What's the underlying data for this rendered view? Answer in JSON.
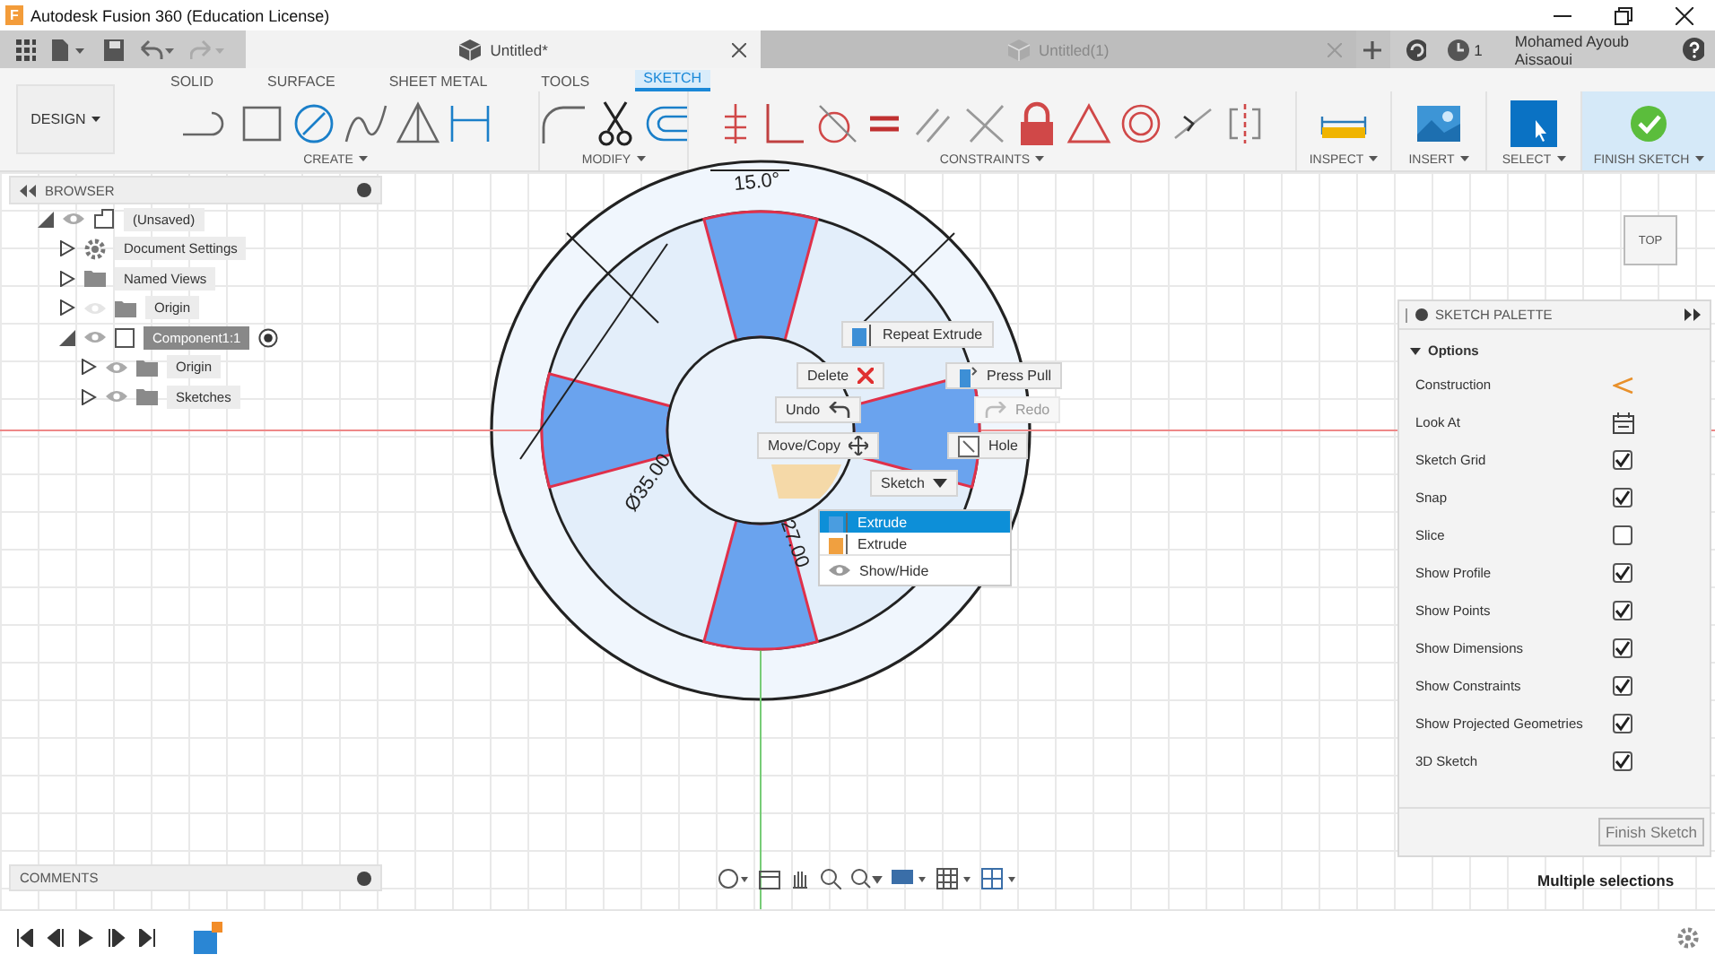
{
  "title_bar": {
    "logo": "F",
    "title": "Autodesk Fusion 360 (Education License)"
  },
  "doc_tabs": [
    {
      "label": "Untitled*",
      "selected": true
    },
    {
      "label": "Untitled(1)",
      "selected": false
    }
  ],
  "notifications": "1",
  "user": "Mohamed Ayoub Aissaoui",
  "ribbon": {
    "workspace": "DESIGN",
    "tabs": [
      {
        "label": "SOLID",
        "selected": false
      },
      {
        "label": "SURFACE",
        "selected": false
      },
      {
        "label": "SHEET METAL",
        "selected": false
      },
      {
        "label": "TOOLS",
        "selected": false
      },
      {
        "label": "SKETCH",
        "selected": true
      }
    ],
    "groups": [
      "CREATE",
      "MODIFY",
      "CONSTRAINTS",
      "INSPECT",
      "INSERT",
      "SELECT",
      "FINISH SKETCH"
    ]
  },
  "browser": {
    "title": "BROWSER",
    "tree": [
      {
        "label": "(Unsaved)",
        "kind": "document",
        "expanded": true,
        "visible": true,
        "selected": false,
        "children": [
          {
            "label": "Document Settings",
            "kind": "settings",
            "expanded": false,
            "selected": false
          },
          {
            "label": "Named Views",
            "kind": "folder",
            "expanded": false,
            "selected": false
          },
          {
            "label": "Origin",
            "kind": "folder",
            "expanded": false,
            "visible": false,
            "selected": false
          },
          {
            "label": "Component1:1",
            "kind": "component",
            "expanded": true,
            "visible": true,
            "active": true,
            "selected": true,
            "children": [
              {
                "label": "Origin",
                "kind": "folder",
                "expanded": false,
                "visible": true,
                "selected": false
              },
              {
                "label": "Sketches",
                "kind": "folder",
                "expanded": false,
                "visible": true,
                "selected": false
              }
            ]
          }
        ]
      }
    ]
  },
  "sketch_labels": [
    "15.0°",
    "Ø35.00",
    "27.00"
  ],
  "marking_menu": [
    {
      "label": "Repeat Extrude",
      "disabled": false
    },
    {
      "label": "Delete",
      "disabled": false
    },
    {
      "label": "Press Pull",
      "disabled": false
    },
    {
      "label": "Undo",
      "disabled": false
    },
    {
      "label": "Redo",
      "disabled": true
    },
    {
      "label": "Move/Copy",
      "disabled": false
    },
    {
      "label": "Hole",
      "disabled": false
    },
    {
      "label": "Sketch",
      "disabled": false
    }
  ],
  "overflow_menu": [
    {
      "label": "Extrude",
      "selected": true
    },
    {
      "label": "Extrude",
      "selected": false
    },
    {
      "label": "Show/Hide",
      "selected": false
    }
  ],
  "view_cube": "TOP",
  "palette": {
    "title": "SKETCH PALETTE",
    "section": "Options",
    "rows": [
      {
        "label": "Construction",
        "kind": "construction"
      },
      {
        "label": "Look At",
        "kind": "look-at"
      },
      {
        "label": "Sketch Grid",
        "kind": "checkbox",
        "checked": true
      },
      {
        "label": "Snap",
        "kind": "checkbox",
        "checked": true
      },
      {
        "label": "Slice",
        "kind": "checkbox",
        "checked": false
      },
      {
        "label": "Show Profile",
        "kind": "checkbox",
        "checked": true
      },
      {
        "label": "Show Points",
        "kind": "checkbox",
        "checked": true
      },
      {
        "label": "Show Dimensions",
        "kind": "checkbox",
        "checked": true
      },
      {
        "label": "Show Constraints",
        "kind": "checkbox",
        "checked": true
      },
      {
        "label": "Show Projected Geometries",
        "kind": "checkbox",
        "checked": true
      },
      {
        "label": "3D Sketch",
        "kind": "checkbox",
        "checked": true
      }
    ],
    "button": "Finish Sketch"
  },
  "comments": "COMMENTS",
  "status": "Multiple selections"
}
